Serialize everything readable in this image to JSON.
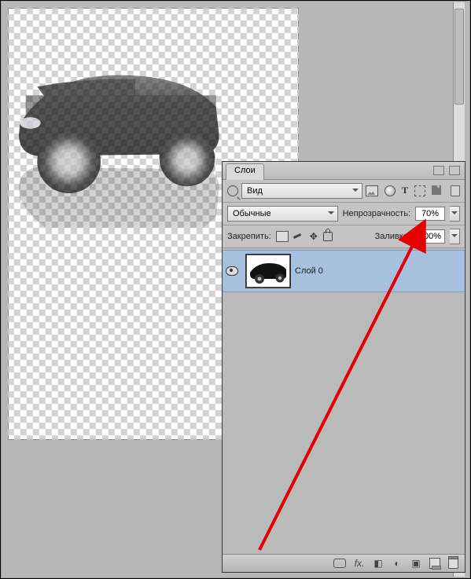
{
  "panel": {
    "tab_label": "Слои",
    "search_type_label": "Вид",
    "blend_mode": "Обычные",
    "opacity_label": "Непрозрачность:",
    "opacity_value": "70%",
    "lock_label": "Закрепить:",
    "fill_label": "Заливка:",
    "fill_value": "100%",
    "filter_icons": {
      "image": "image-filter-icon",
      "adjust": "adjustment-filter-icon",
      "text": "text-filter-icon",
      "shape": "shape-filter-icon",
      "smart": "smart-object-filter-icon"
    }
  },
  "layers": [
    {
      "name": "Слой 0",
      "visible": true,
      "selected": true
    }
  ],
  "footer_icons": {
    "link": "link-layers-icon",
    "fx": "layer-style-icon",
    "mask": "layer-mask-icon",
    "adjust": "adjustment-layer-icon",
    "group": "new-group-icon",
    "new": "new-layer-icon",
    "trash": "delete-layer-icon"
  },
  "icon_glyphs": {
    "fx": "fx.",
    "T": "T",
    "move": "✥",
    "mask": "◧",
    "adjust": "◐",
    "group": "▣"
  }
}
